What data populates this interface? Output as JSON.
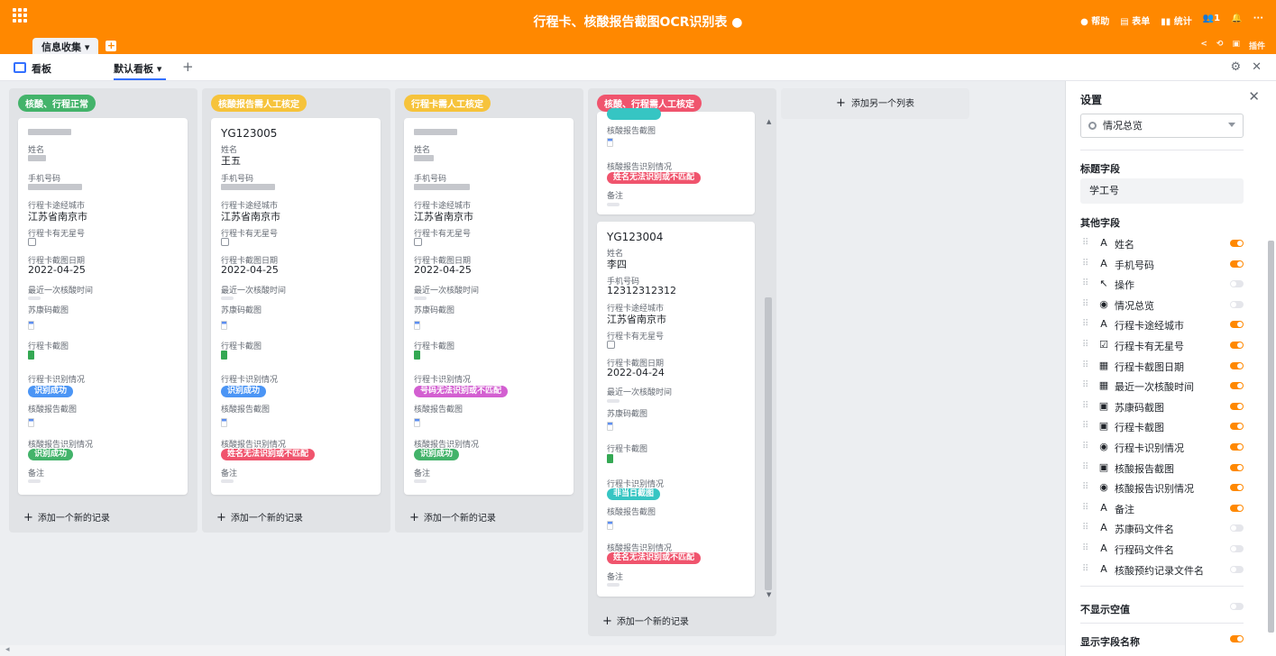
{
  "topbar": {
    "title": "行程卡、核酸报告截图OCR识别表 ●",
    "actions": [
      "● 帮助",
      "▤ 表单",
      "▮▮ 统计",
      "👥1",
      "🔔",
      "···"
    ],
    "tab": "信息收集 ▾",
    "tab_add": "+",
    "right_tools": [
      "<",
      "⟲",
      "▣",
      "插件"
    ]
  },
  "subbar": {
    "board_label": "看板",
    "view_tab": "默认看板 ▾",
    "add": "+",
    "settings_icon": "⚙",
    "close_icon": "✕"
  },
  "colors": {
    "brand": "#ff8800",
    "green": "#43b36a",
    "yellow": "#f6c33b",
    "red": "#f0546d",
    "blue": "#4b95f5",
    "purple": "#d35fd1",
    "teal": "#36c5c3"
  },
  "columns": [
    {
      "header": "核酸、行程正常"
    },
    {
      "header": "核酸报告需人工核定"
    },
    {
      "header": "行程卡需人工核定"
    },
    {
      "header": "核酸、行程需人工核定"
    }
  ],
  "fields": {
    "name": "姓名",
    "phone": "手机号码",
    "city": "行程卡途经城市",
    "star": "行程卡有无星号",
    "date": "行程卡截图日期",
    "last_test": "最近一次核酸时间",
    "sukang": "苏康码截图",
    "trip_img": "行程卡截图",
    "trip_status": "行程卡识别情况",
    "report_img": "核酸报告截图",
    "report_status": "核酸报告识别情况",
    "remark": "备注"
  },
  "cards": {
    "c2": {
      "id": "YG123005",
      "name": "王五",
      "city": "江苏省南京市",
      "date": "2022-04-25",
      "trip": "识别成功",
      "report": "姓名无法识别或不匹配"
    },
    "c1": {
      "city": "江苏省南京市",
      "date": "2022-04-25",
      "trip": "识别成功",
      "report": "识别成功"
    },
    "c3": {
      "city": "江苏省南京市",
      "date": "2022-04-25",
      "trip": "号码无法识别或不匹配",
      "report": "识别成功"
    },
    "c4top": {
      "report": "姓名无法识别或不匹配"
    },
    "c4": {
      "id": "YG123004",
      "name": "李四",
      "phone": "12312312312",
      "city": "江苏省南京市",
      "date": "2022-04-24",
      "trip": "非当日截图",
      "report": "姓名无法识别或不匹配"
    }
  },
  "board": {
    "add_record": "添加一个新的记录",
    "add_list": "添加另一个列表",
    "plus": "+"
  },
  "panel": {
    "title": "设置",
    "close": "✕",
    "select_value": "情况总览",
    "title_field_label": "标题字段",
    "title_field_value": "学工号",
    "other_fields_label": "其他字段",
    "fields": [
      {
        "icon": "A",
        "name": "姓名",
        "on": true
      },
      {
        "icon": "A",
        "name": "手机号码",
        "on": true
      },
      {
        "icon": "↖",
        "name": "操作",
        "on": false
      },
      {
        "icon": "◉",
        "name": "情况总览",
        "on": false
      },
      {
        "icon": "A",
        "name": "行程卡途经城市",
        "on": true
      },
      {
        "icon": "☑",
        "name": "行程卡有无星号",
        "on": true
      },
      {
        "icon": "▦",
        "name": "行程卡截图日期",
        "on": true
      },
      {
        "icon": "▦",
        "name": "最近一次核酸时间",
        "on": true
      },
      {
        "icon": "▣",
        "name": "苏康码截图",
        "on": true
      },
      {
        "icon": "▣",
        "name": "行程卡截图",
        "on": true
      },
      {
        "icon": "◉",
        "name": "行程卡识别情况",
        "on": true
      },
      {
        "icon": "▣",
        "name": "核酸报告截图",
        "on": true
      },
      {
        "icon": "◉",
        "name": "核酸报告识别情况",
        "on": true
      },
      {
        "icon": "A",
        "name": "备注",
        "on": true
      },
      {
        "icon": "A",
        "name": "苏康码文件名",
        "on": false
      },
      {
        "icon": "A",
        "name": "行程码文件名",
        "on": false
      },
      {
        "icon": "A",
        "name": "核酸预约记录文件名",
        "on": false
      }
    ],
    "hide_empty": "不显示空值",
    "show_names": "显示字段名称"
  }
}
